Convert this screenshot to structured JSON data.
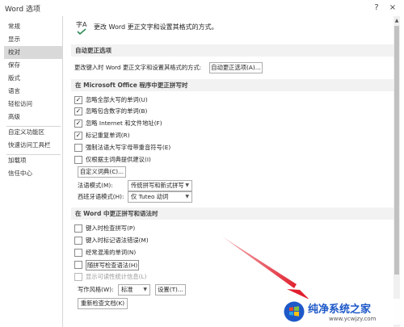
{
  "window": {
    "title": "Word 选项",
    "help_glyph": "?",
    "close_glyph": "×"
  },
  "sidebar": {
    "items": [
      {
        "label": "常规"
      },
      {
        "label": "显示"
      },
      {
        "label": "校对",
        "active": true
      },
      {
        "label": "保存"
      },
      {
        "label": "版式"
      },
      {
        "label": "语言"
      },
      {
        "label": "轻松访问"
      },
      {
        "label": "高级"
      },
      {
        "label": "自定义功能区"
      },
      {
        "label": "快速访问工具栏"
      },
      {
        "label": "加载项"
      },
      {
        "label": "信任中心"
      }
    ]
  },
  "header": {
    "icon_text": "字A",
    "description": "更改 Word 更正文字和设置其格式的方式。"
  },
  "autocorrect": {
    "heading": "自动更正选项",
    "description": "更改键入时 Word 更正文字和设置其格式的方式:",
    "button": "自动更正选项(A)..."
  },
  "office_spelling": {
    "heading": "在 Microsoft Office 程序中更正拼写时",
    "options": [
      {
        "label": "忽略全部大写的单词(U)",
        "checked": true,
        "enabled": true
      },
      {
        "label": "忽略包含数字的单词(B)",
        "checked": true,
        "enabled": true
      },
      {
        "label": "忽略 Internet 和文件地址(F)",
        "checked": true,
        "enabled": true
      },
      {
        "label": "标记重复单词(R)",
        "checked": true,
        "enabled": true
      },
      {
        "label": "强制法语大写字母带重音符号(E)",
        "checked": false,
        "enabled": true
      },
      {
        "label": "仅根据主词典提供建议(I)",
        "checked": false,
        "enabled": true
      }
    ],
    "custom_dict_button": "自定义词典(C)...",
    "french_label": "法语模式(M):",
    "french_value": "传统拼写和新式拼写",
    "spanish_label": "西班牙语模式(H):",
    "spanish_value": "仅 Tuteo 动词"
  },
  "word_spelling": {
    "heading": "在 Word 中更正拼写和语法时",
    "options": [
      {
        "label": "键入时检查拼写(P)",
        "checked": false,
        "enabled": true
      },
      {
        "label": "键入时标记语法错误(M)",
        "checked": false,
        "enabled": true
      },
      {
        "label": "经常混淆的单词(N)",
        "checked": false,
        "enabled": true
      },
      {
        "label": "随拼写检查语法(H)",
        "checked": false,
        "enabled": true
      },
      {
        "label": "显示可读性统计信息(L)",
        "checked": false,
        "enabled": false
      }
    ],
    "style_label": "写作风格(W):",
    "style_value": "标准",
    "settings_button": "设置(T)...",
    "recheck_button": "重新检查文档(K)"
  },
  "colors": {
    "arrow": "#e0202e",
    "watermark_text": "#1d58c8"
  },
  "watermark": {
    "name": "纯净系统之家",
    "url": "www.ycwjzy.com"
  }
}
